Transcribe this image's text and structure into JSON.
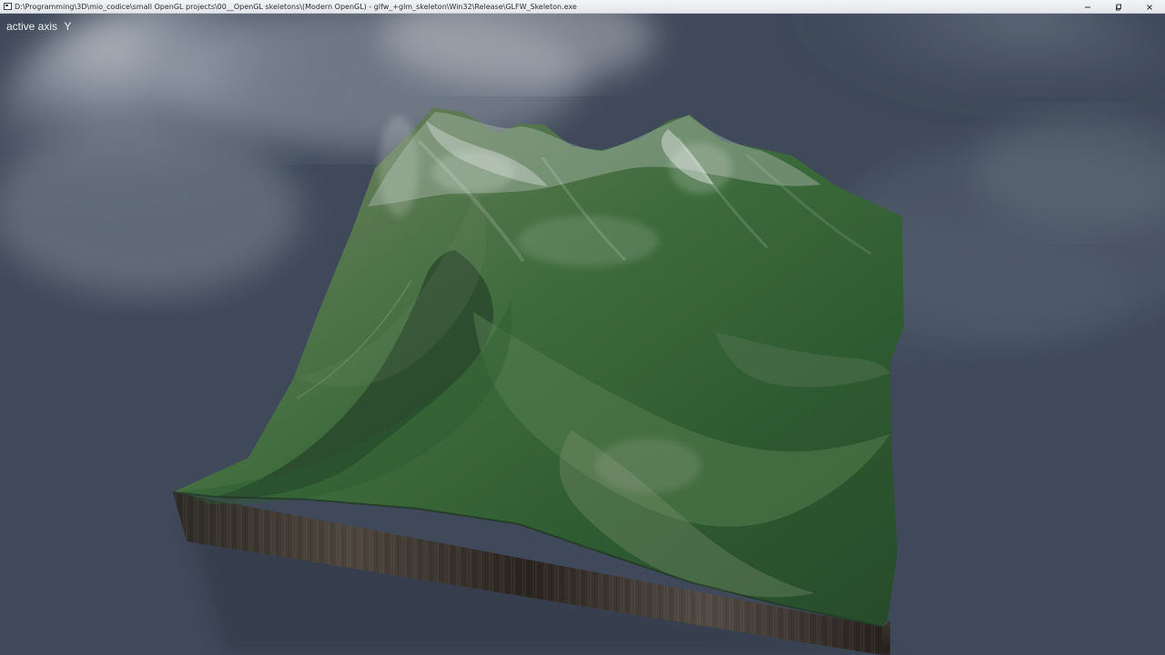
{
  "window": {
    "title": "D:\\Programming\\3D\\mio_codice\\small OpenGL projects\\00__OpenGL skeletons\\(Modern OpenGL) - glfw_+glm_skeleton\\Win32\\Release\\GLFW_Skeleton.exe",
    "controls": {
      "minimize_icon": "minimize-icon",
      "restore_icon": "restore-icon",
      "close_icon": "close-icon"
    }
  },
  "viewport": {
    "active_axis_label": "active axis",
    "active_axis_value": "Y",
    "scene_object": "terrain",
    "sky": "cloudy"
  },
  "colors": {
    "titlebar": "#eceef1",
    "sky_dark": "#36404f",
    "sky_mid": "#485465",
    "terrain_green": "#3d6a3f",
    "terrain_base": "#2f2a25",
    "hud_text": "#f2f4f7"
  }
}
